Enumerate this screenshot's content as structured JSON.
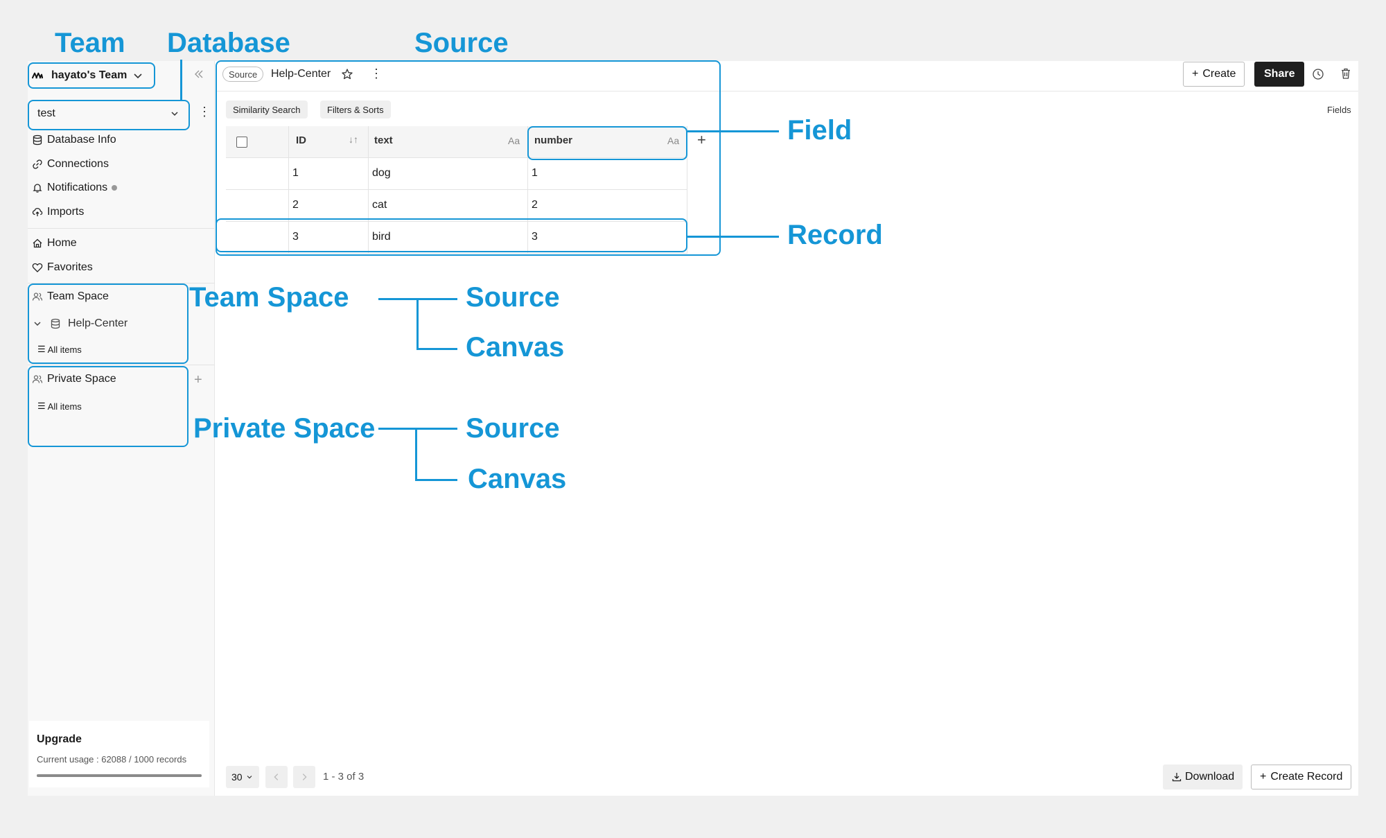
{
  "annotations": {
    "team": "Team",
    "database": "Database",
    "source_top": "Source",
    "field": "Field",
    "record": "Record",
    "team_space": "Team Space",
    "team_source": "Source",
    "team_canvas": "Canvas",
    "private_space": "Private Space",
    "private_source": "Source",
    "private_canvas": "Canvas"
  },
  "sidebar": {
    "team_name": "hayato's Team",
    "database_select": "test",
    "nav": [
      {
        "label": "Database Info",
        "icon": "database-icon"
      },
      {
        "label": "Connections",
        "icon": "link-icon"
      },
      {
        "label": "Notifications",
        "icon": "bell-icon"
      },
      {
        "label": "Imports",
        "icon": "cloud-upload-icon"
      }
    ],
    "home": "Home",
    "favorites": "Favorites",
    "team_space": {
      "label": "Team Space",
      "source": "Help-Center",
      "all_items": "All items"
    },
    "private_space": {
      "label": "Private Space",
      "all_items": "All items"
    },
    "upgrade": {
      "title": "Upgrade",
      "usage": "Current usage : 62088 / 1000 records",
      "progress": 1.0
    }
  },
  "topbar": {
    "source_pill": "Source",
    "title": "Help-Center",
    "create": "Create",
    "share": "Share"
  },
  "toolbar": {
    "similarity": "Similarity Search",
    "filters": "Filters & Sorts",
    "fields": "Fields"
  },
  "table": {
    "columns": [
      {
        "label": "ID",
        "type_icon": "sort-icon"
      },
      {
        "label": "text",
        "type_icon": "Aa"
      },
      {
        "label": "number",
        "type_icon": "Aa"
      }
    ],
    "rows": [
      {
        "id": "1",
        "text": "dog",
        "number": "1"
      },
      {
        "id": "2",
        "text": "cat",
        "number": "2"
      },
      {
        "id": "3",
        "text": "bird",
        "number": "3"
      }
    ]
  },
  "footer": {
    "page_size": "30",
    "range": "1 - 3 of 3",
    "download": "Download",
    "create_record": "Create Record"
  },
  "colors": {
    "accent": "#1596d6",
    "dark_button": "#1f1f1f"
  }
}
